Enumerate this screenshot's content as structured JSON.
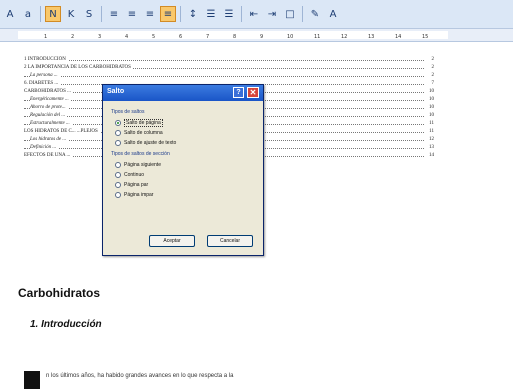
{
  "toolbar": {
    "buttons": [
      {
        "icon": "font-size-increase-icon",
        "glyph": "A"
      },
      {
        "icon": "font-size-decrease-icon",
        "glyph": "a"
      },
      {
        "icon": "bold-icon",
        "glyph": "N",
        "active": true
      },
      {
        "icon": "italic-icon",
        "glyph": "K"
      },
      {
        "icon": "underline-icon",
        "glyph": "S"
      },
      {
        "icon": "align-left-icon",
        "glyph": "≡"
      },
      {
        "icon": "align-center-icon",
        "glyph": "≡"
      },
      {
        "icon": "align-right-icon",
        "glyph": "≡"
      },
      {
        "icon": "justify-icon",
        "glyph": "≡",
        "active": true
      },
      {
        "icon": "line-spacing-icon",
        "glyph": "↕"
      },
      {
        "icon": "numbering-icon",
        "glyph": "☰"
      },
      {
        "icon": "bullets-icon",
        "glyph": "☰"
      },
      {
        "icon": "decrease-indent-icon",
        "glyph": "⇤"
      },
      {
        "icon": "increase-indent-icon",
        "glyph": "⇥"
      },
      {
        "icon": "borders-icon",
        "glyph": "□"
      },
      {
        "icon": "highlight-icon",
        "glyph": "✎"
      },
      {
        "icon": "font-color-icon",
        "glyph": "A"
      }
    ]
  },
  "ruler": {
    "ticks": [
      "1",
      "2",
      "3",
      "4",
      "5",
      "6",
      "7",
      "8",
      "9",
      "10",
      "11",
      "12",
      "13",
      "14",
      "15"
    ]
  },
  "toc": [
    {
      "text": "1   INTRODUCCIÓN",
      "page": "2",
      "italic": false
    },
    {
      "text": "2   LA IMPORTANCIA DE LOS CARBOHIDRATOS",
      "page": "2",
      "italic": false
    },
    {
      "text": "La persona ...",
      "page": "2",
      "italic": true
    },
    {
      "text": "6. DIABETES ...",
      "page": "7",
      "italic": false
    },
    {
      "text": "CARBOHIDRATOS ...",
      "page": "10",
      "italic": false
    },
    {
      "text": "Energéticamente ...",
      "page": "10",
      "italic": true
    },
    {
      "text": "Ahorro de prote...",
      "page": "10",
      "italic": true
    },
    {
      "text": "Regulación del ...",
      "page": "10",
      "italic": true
    },
    {
      "text": "Estructuralmente ...",
      "page": "11",
      "italic": true
    },
    {
      "text": "LOS HIDRATOS DE C...   ...PLEJOS",
      "page": "11",
      "italic": false
    },
    {
      "text": "Los hidratos de ...",
      "page": "12",
      "italic": true
    },
    {
      "text": "Definición ...",
      "page": "13",
      "italic": true
    },
    {
      "text": "EFECTOS DE UNA ...",
      "page": "14",
      "italic": false
    }
  ],
  "document": {
    "heading": "Carbohidratos",
    "subheading": "1. Introducción",
    "body_text": "n los últimos años, ha habido grandes avances en lo que respecta a la"
  },
  "dialog": {
    "title": "Salto",
    "help_glyph": "?",
    "close_glyph": "✕",
    "group1_label": "Tipos de saltos",
    "group1_options": [
      {
        "label": "Salto de página",
        "selected": true,
        "focus": true
      },
      {
        "label": "Salto de columna",
        "selected": false,
        "focus": false
      },
      {
        "label": "Salto de ajuste de texto",
        "selected": false,
        "focus": false
      }
    ],
    "group2_label": "Tipos de saltos de sección",
    "group2_options": [
      {
        "label": "Página siguiente",
        "selected": false
      },
      {
        "label": "Continuo",
        "selected": false
      },
      {
        "label": "Página par",
        "selected": false
      },
      {
        "label": "Página impar",
        "selected": false
      }
    ],
    "accept_label": "Aceptar",
    "cancel_label": "Cancelar"
  }
}
